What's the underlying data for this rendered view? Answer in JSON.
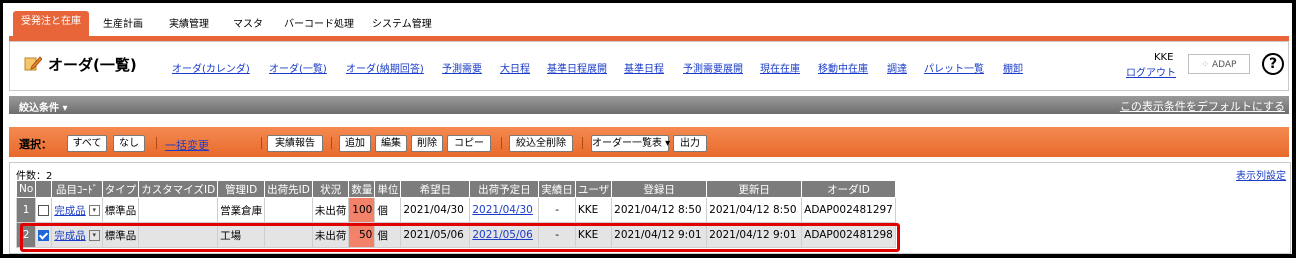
{
  "tabs": [
    "受発注と在庫",
    "生産計画",
    "実績管理",
    "マスタ",
    "バーコード処理",
    "システム管理"
  ],
  "page_title": "オーダ(一覧)",
  "nav_links": [
    "オーダ(カレンダ)",
    "オーダ(一覧)",
    "オーダ(納期回答)",
    "予測需要",
    "大日程",
    "基準日程展開",
    "基準日程",
    "予測需要展開",
    "現在在庫",
    "移動中在庫",
    "調達",
    "パレット一覧",
    "棚卸"
  ],
  "user": {
    "name": "KKE",
    "logout": "ログアウト"
  },
  "logo_text": "ADAP",
  "help_symbol": "?",
  "filter": {
    "label": "絞込条件",
    "default_link": "この表示条件をデフォルトにする"
  },
  "toolbar": {
    "select_label": "選択：",
    "all": "すべて",
    "none": "なし",
    "bulk_change": "一括変更",
    "result_report": "実績報告",
    "add": "追加",
    "edit": "編集",
    "delete": "削除",
    "copy": "コピー",
    "clear_filters": "絞込全削除",
    "view_select": "オーダー一覧表",
    "output": "出力"
  },
  "list": {
    "count_label": "件数：",
    "count": "2",
    "column_settings": "表示列設定",
    "headers": [
      "No",
      "品目ｺｰﾄﾞ",
      "タイプ",
      "カスタマイズID",
      "管理ID",
      "出荷先ID",
      "状況",
      "数量",
      "単位",
      "希望日",
      "出荷予定日",
      "実績日",
      "ユーザ",
      "登録日",
      "更新日",
      "オーダID"
    ],
    "rows": [
      {
        "no": "1",
        "checked": false,
        "item": "完成品",
        "type": "標準品",
        "custom_id": "",
        "mgmt_id": "営業倉庫",
        "ship_id": "",
        "status": "未出荷",
        "qty": "100",
        "unit": "個",
        "desired": "2021/04/30",
        "planned": "2021/04/30",
        "actual": "-",
        "user": "KKE",
        "created": "2021/04/12 8:50",
        "updated": "2021/04/12 8:50",
        "order_id": "ADAP002481297"
      },
      {
        "no": "2",
        "checked": true,
        "item": "完成品",
        "type": "標準品",
        "custom_id": "",
        "mgmt_id": "工場",
        "ship_id": "",
        "status": "未出荷",
        "qty": "50",
        "unit": "個",
        "desired": "2021/05/06",
        "planned": "2021/05/06",
        "actual": "-",
        "user": "KKE",
        "created": "2021/04/12 9:01",
        "updated": "2021/04/12 9:01",
        "order_id": "ADAP002481298"
      }
    ]
  }
}
